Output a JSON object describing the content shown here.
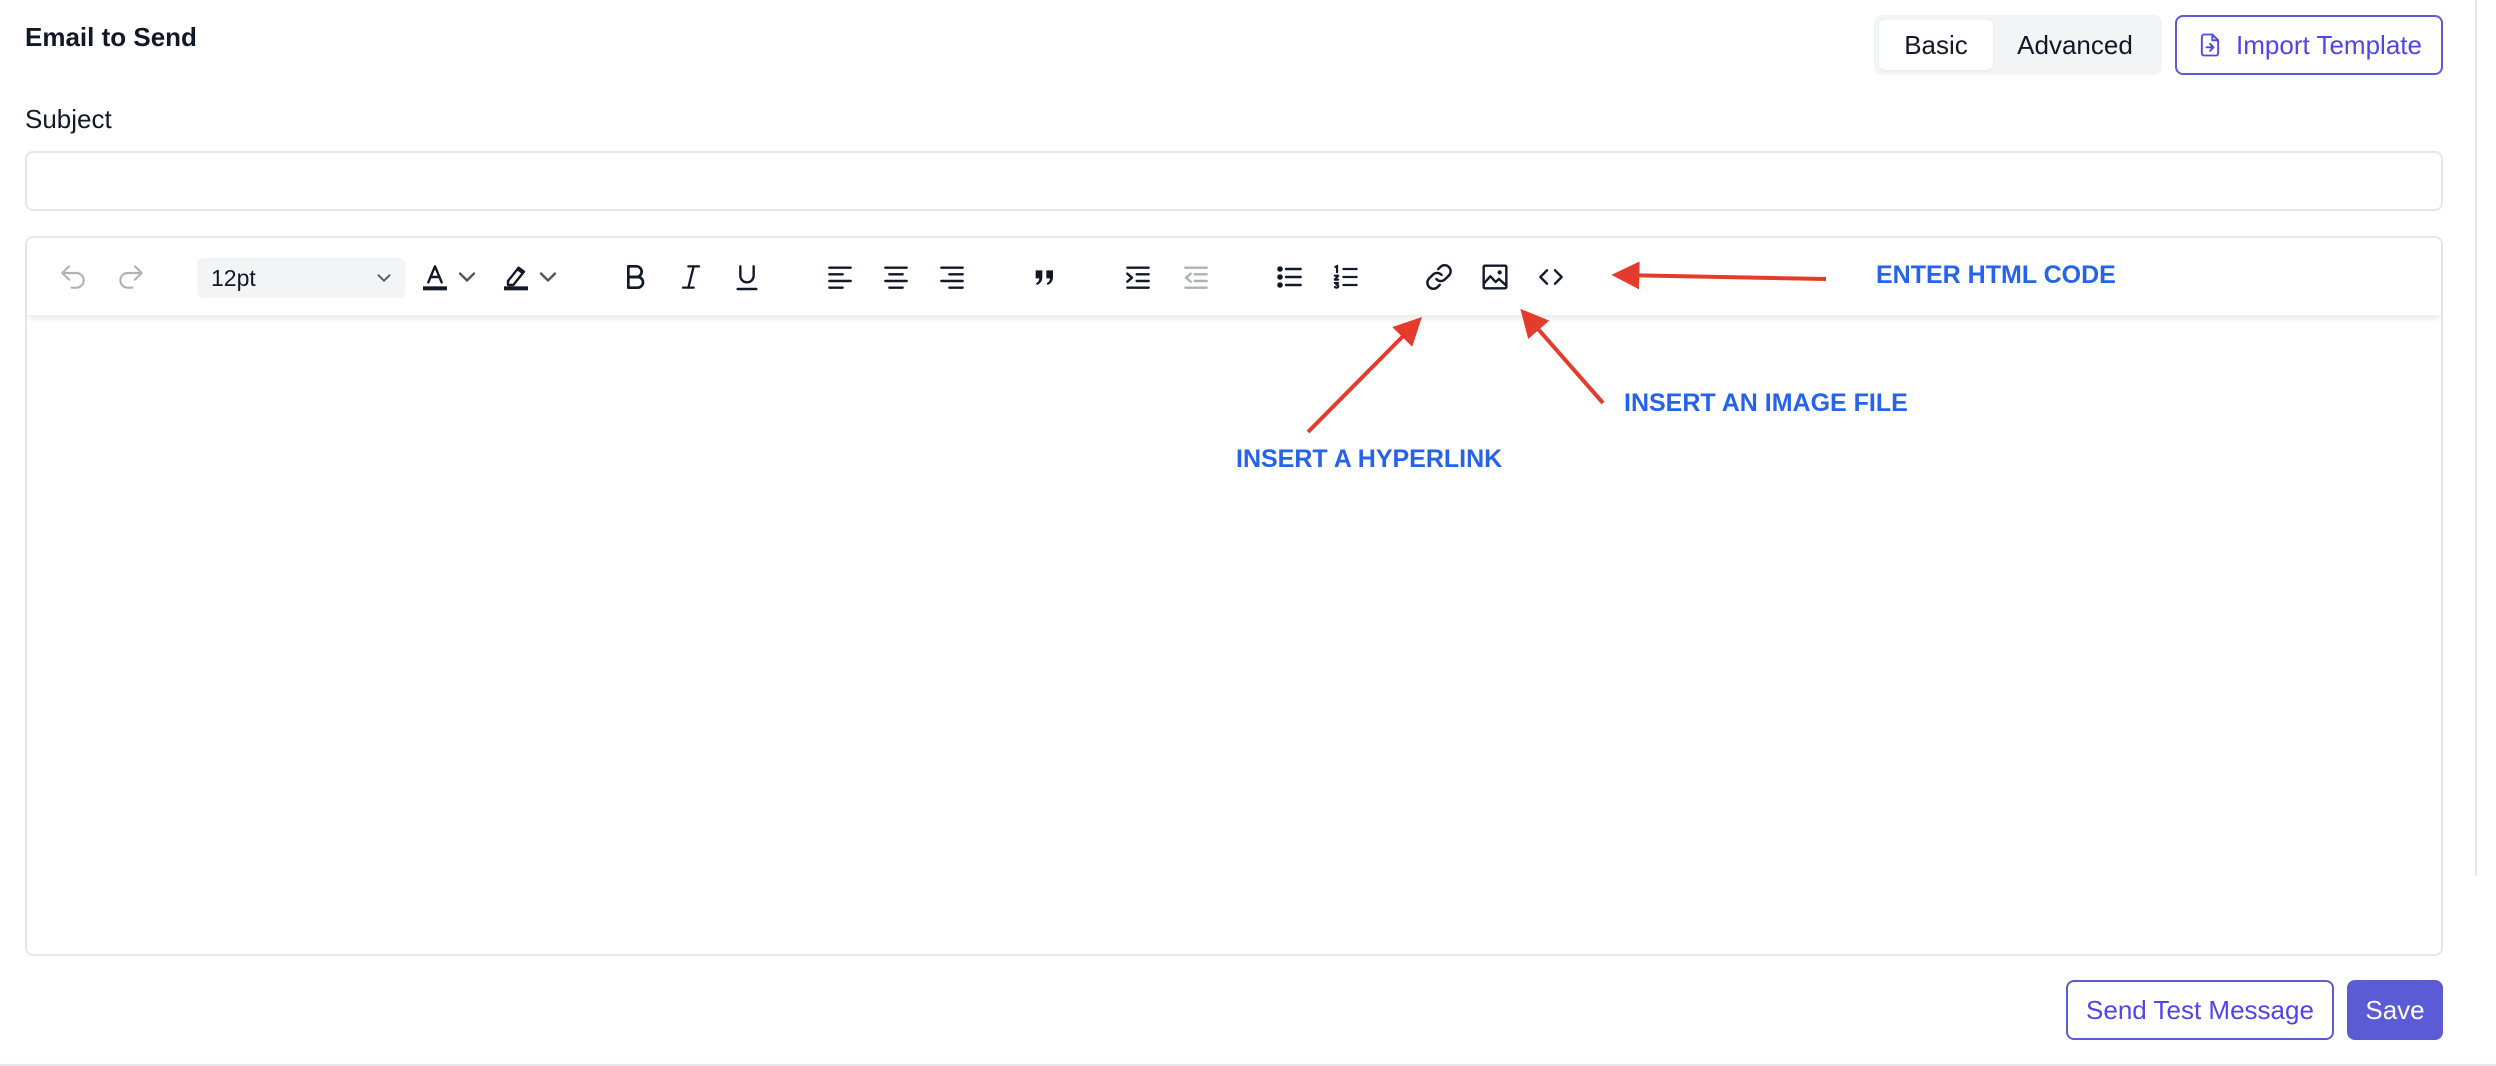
{
  "header": {
    "title": "Email to Send"
  },
  "mode_toggle": {
    "options": [
      "Basic",
      "Advanced"
    ],
    "selected": "Basic"
  },
  "import_button": {
    "label": "Import Template",
    "icon": "file-import-icon"
  },
  "subject": {
    "label": "Subject",
    "value": "",
    "placeholder": ""
  },
  "toolbar": {
    "font_size": "12pt",
    "icons": [
      "undo-icon",
      "redo-icon",
      "text-color-icon",
      "highlight-icon",
      "bold-icon",
      "italic-icon",
      "underline-icon",
      "align-left-icon",
      "align-center-icon",
      "align-right-icon",
      "blockquote-icon",
      "indent-icon",
      "outdent-icon",
      "bullet-list-icon",
      "numbered-list-icon",
      "link-icon",
      "image-icon",
      "code-icon"
    ]
  },
  "annotations": {
    "html_code": "ENTER HTML CODE",
    "image_file": "INSERT AN IMAGE FILE",
    "hyperlink": "INSERT A HYPERLINK"
  },
  "footer": {
    "test_button": "Send Test Message",
    "save_button": "Save"
  },
  "colors": {
    "accent": "#5b5bd6",
    "annotation_text": "#2563eb",
    "annotation_arrow": "#e53b2c",
    "border": "#e5e7eb"
  }
}
